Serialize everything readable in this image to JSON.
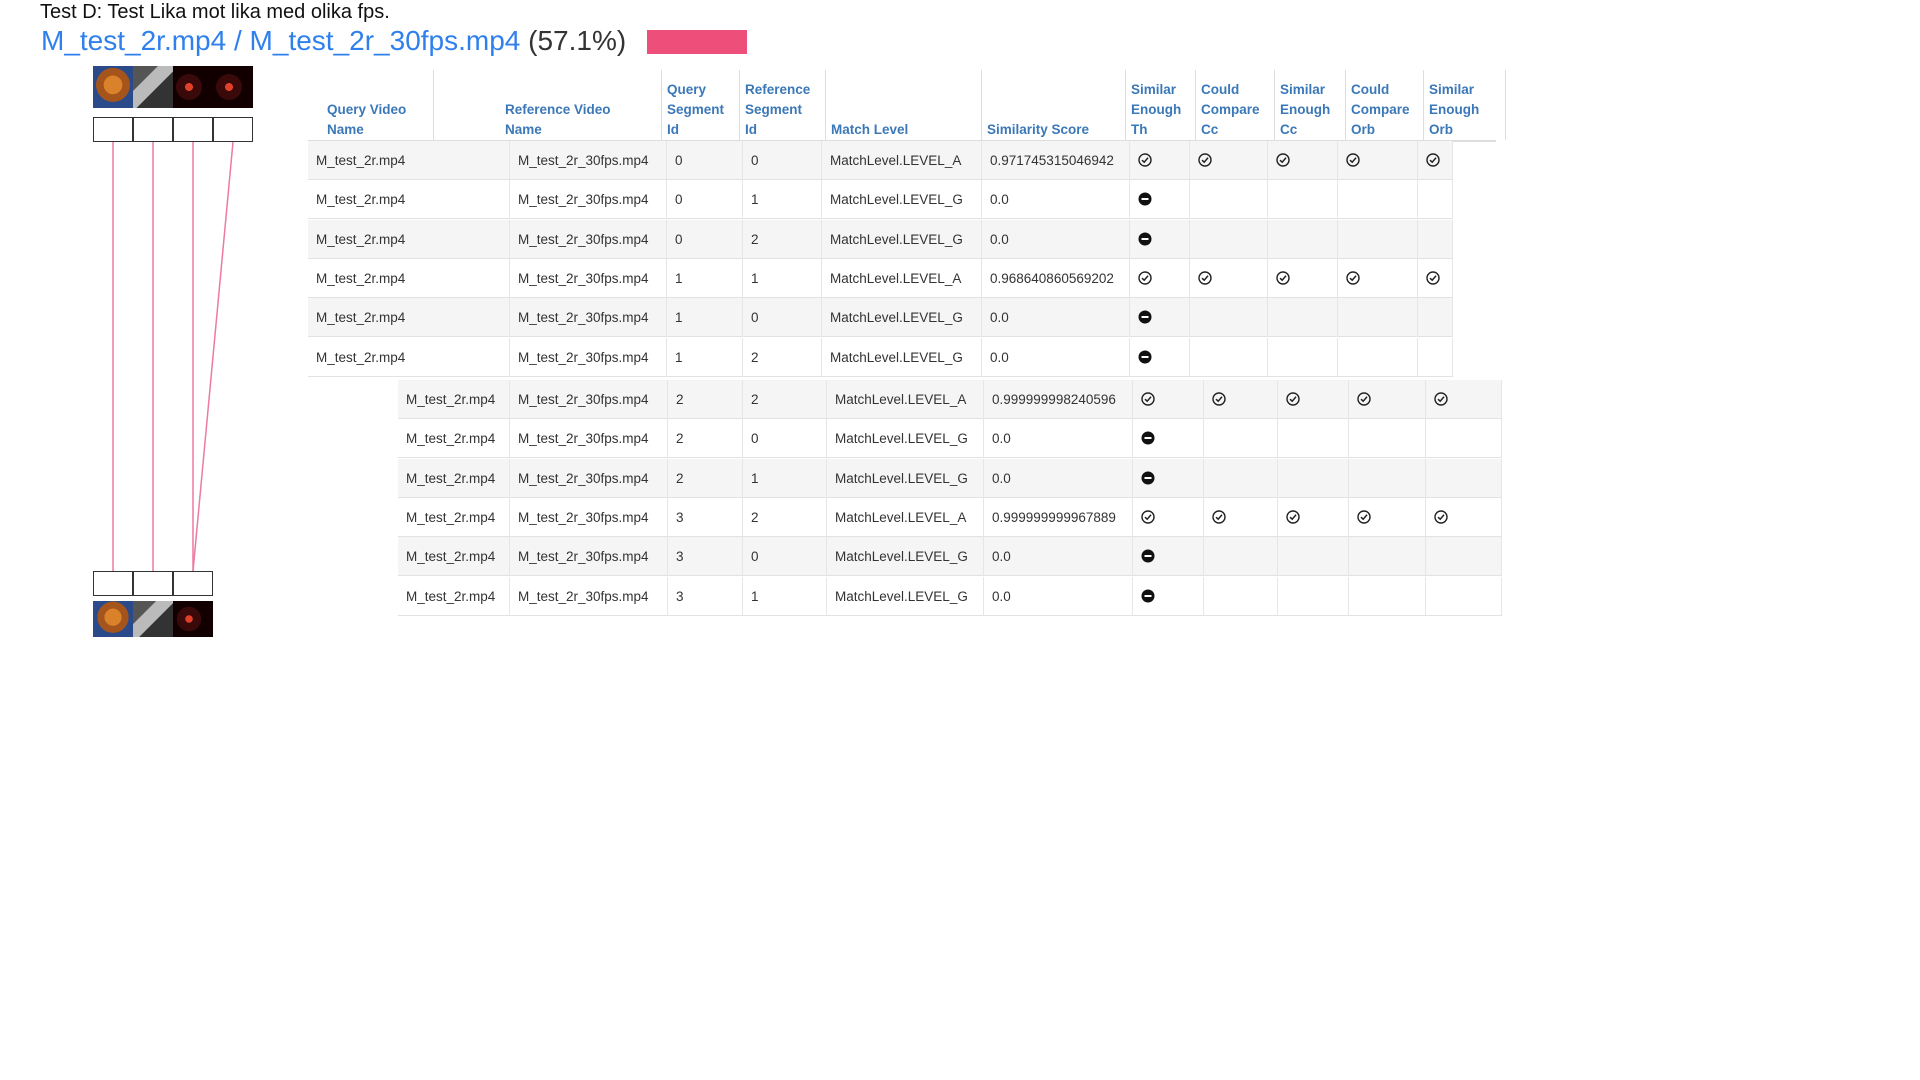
{
  "header": {
    "test_title": "Test D: Test Lika mot lika med olika fps.",
    "query_file": "M_test_2r.mp4",
    "separator": "/",
    "reference_file": "M_test_2r_30fps.mp4",
    "percent": "(57.1%)",
    "progress_fraction": 0.571
  },
  "table": {
    "columns": [
      [
        "Query Video",
        "Name"
      ],
      [
        "Reference Video",
        "Name"
      ],
      [
        "Query",
        "Segment",
        "Id"
      ],
      [
        "Reference",
        "Segment",
        "Id"
      ],
      [
        "Match Level"
      ],
      [
        "Similarity Score"
      ],
      [
        "Similar",
        "Enough",
        "Th"
      ],
      [
        "Could",
        "Compare",
        "Cc"
      ],
      [
        "Similar",
        "Enough",
        "Cc"
      ],
      [
        "Could",
        "Compare",
        "Orb"
      ],
      [
        "Similar",
        "Enough",
        "Orb"
      ]
    ],
    "rows": [
      {
        "query": "M_test_2r.mp4",
        "reference": "M_test_2r_30fps.mp4",
        "qseg": "0",
        "rseg": "0",
        "level": "MatchLevel.LEVEL_A",
        "score": "0.971745315046942",
        "flags": [
          "check",
          "check",
          "check",
          "check",
          "check"
        ]
      },
      {
        "query": "M_test_2r.mp4",
        "reference": "M_test_2r_30fps.mp4",
        "qseg": "0",
        "rseg": "1",
        "level": "MatchLevel.LEVEL_G",
        "score": "0.0",
        "flags": [
          "minus",
          "",
          "",
          "",
          ""
        ]
      },
      {
        "query": "M_test_2r.mp4",
        "reference": "M_test_2r_30fps.mp4",
        "qseg": "0",
        "rseg": "2",
        "level": "MatchLevel.LEVEL_G",
        "score": "0.0",
        "flags": [
          "minus",
          "",
          "",
          "",
          ""
        ]
      },
      {
        "query": "M_test_2r.mp4",
        "reference": "M_test_2r_30fps.mp4",
        "qseg": "1",
        "rseg": "1",
        "level": "MatchLevel.LEVEL_A",
        "score": "0.968640860569202",
        "flags": [
          "check",
          "check",
          "check",
          "check",
          "check"
        ]
      },
      {
        "query": "M_test_2r.mp4",
        "reference": "M_test_2r_30fps.mp4",
        "qseg": "1",
        "rseg": "0",
        "level": "MatchLevel.LEVEL_G",
        "score": "0.0",
        "flags": [
          "minus",
          "",
          "",
          "",
          ""
        ]
      },
      {
        "query": "M_test_2r.mp4",
        "reference": "M_test_2r_30fps.mp4",
        "qseg": "1",
        "rseg": "2",
        "level": "MatchLevel.LEVEL_G",
        "score": "0.0",
        "flags": [
          "minus",
          "",
          "",
          "",
          ""
        ]
      },
      {
        "query": "M_test_2r.mp4",
        "reference": "M_test_2r_30fps.mp4",
        "qseg": "2",
        "rseg": "2",
        "level": "MatchLevel.LEVEL_A",
        "score": "0.999999998240596",
        "flags": [
          "check",
          "check",
          "check",
          "check",
          "check"
        ]
      },
      {
        "query": "M_test_2r.mp4",
        "reference": "M_test_2r_30fps.mp4",
        "qseg": "2",
        "rseg": "0",
        "level": "MatchLevel.LEVEL_G",
        "score": "0.0",
        "flags": [
          "minus",
          "",
          "",
          "",
          ""
        ]
      },
      {
        "query": "M_test_2r.mp4",
        "reference": "M_test_2r_30fps.mp4",
        "qseg": "2",
        "rseg": "1",
        "level": "MatchLevel.LEVEL_G",
        "score": "0.0",
        "flags": [
          "minus",
          "",
          "",
          "",
          ""
        ]
      },
      {
        "query": "M_test_2r.mp4",
        "reference": "M_test_2r_30fps.mp4",
        "qseg": "3",
        "rseg": "2",
        "level": "MatchLevel.LEVEL_A",
        "score": "0.999999999967889",
        "flags": [
          "check",
          "check",
          "check",
          "check",
          "check"
        ]
      },
      {
        "query": "M_test_2r.mp4",
        "reference": "M_test_2r_30fps.mp4",
        "qseg": "3",
        "rseg": "0",
        "level": "MatchLevel.LEVEL_G",
        "score": "0.0",
        "flags": [
          "minus",
          "",
          "",
          "",
          ""
        ]
      },
      {
        "query": "M_test_2r.mp4",
        "reference": "M_test_2r_30fps.mp4",
        "qseg": "3",
        "rseg": "1",
        "level": "MatchLevel.LEVEL_G",
        "score": "0.0",
        "flags": [
          "minus",
          "",
          "",
          "",
          ""
        ]
      }
    ]
  },
  "visualization": {
    "query_segments": 4,
    "reference_segments": 3,
    "links": [
      [
        0,
        0
      ],
      [
        1,
        1
      ],
      [
        2,
        2
      ],
      [
        3,
        2
      ]
    ],
    "link_color": "#ed7aa0",
    "query_thumbs": [
      "orange-tree-thumbnail",
      "grey-scene-thumbnail",
      "red-night-thumbnail",
      "red-night-thumbnail"
    ],
    "reference_thumbs": [
      "orange-tree-thumbnail",
      "grey-scene-thumbnail",
      "red-night-thumbnail"
    ]
  },
  "colors": {
    "accent": "#2f80ed",
    "bar": "#ed4f7a",
    "header_text": "#3b78b8"
  }
}
